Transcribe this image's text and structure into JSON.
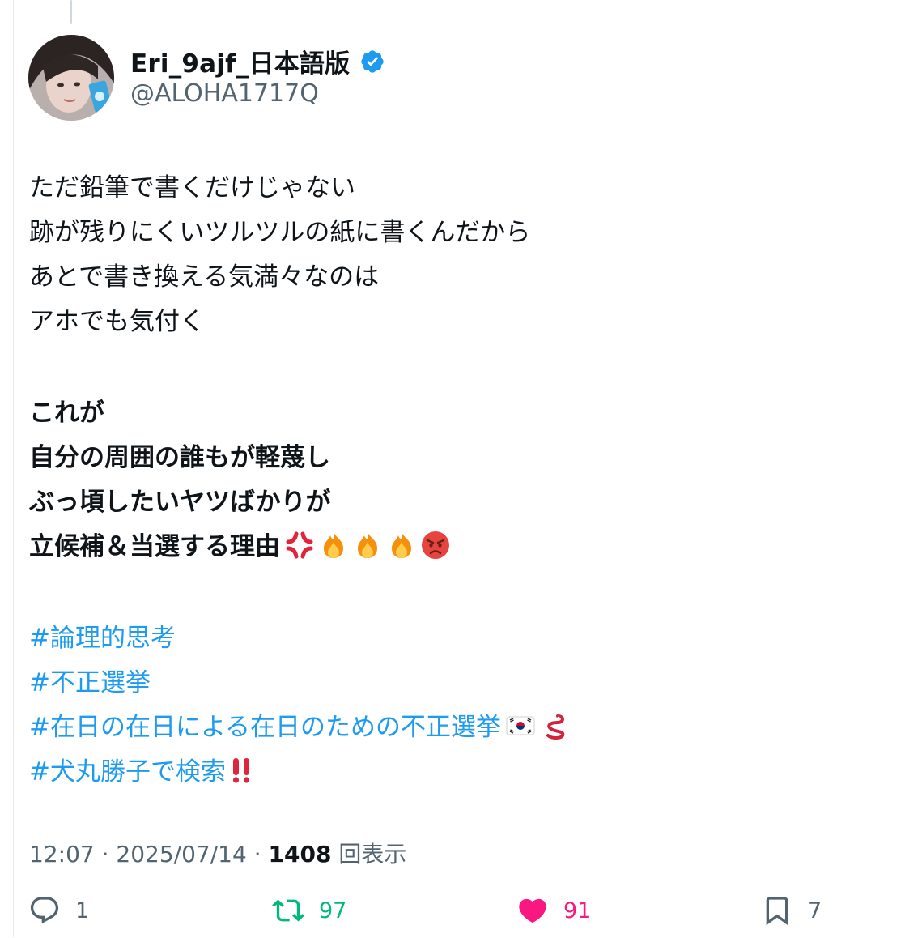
{
  "author": {
    "display_name": "Eri_9ajf_日本語版",
    "handle": "@ALOHA1717Q"
  },
  "tweet": {
    "paragraph1": [
      "ただ鉛筆で書くだけじゃない",
      "跡が残りにくいツルツルの紙に書くんだから",
      "あとで書き換える気満々なのは",
      "アホでも気付く"
    ],
    "paragraph2": [
      "これが",
      "自分の周囲の誰もが軽蔑し",
      "ぶっ頃したいヤツばかりが",
      "立候補＆当選する理由"
    ],
    "hashtags": [
      "#論理的思考",
      "#不正選挙",
      "#在日の在日による在日のための不正選挙",
      "#犬丸勝子で検索"
    ],
    "emoji_names": [
      "anger-symbol",
      "fire",
      "fire",
      "fire",
      "pouting-face",
      "korean-flag",
      "snake",
      "double-exclamation"
    ]
  },
  "meta": {
    "time": "12:07",
    "date": "2025/07/14",
    "views": "1408",
    "views_label": "回表示"
  },
  "actions": {
    "replies": "1",
    "retweets": "97",
    "likes": "91",
    "bookmarks": "7"
  },
  "colors": {
    "accent": "#1d9bf0",
    "retweet": "#00ba7c",
    "like": "#f91880",
    "muted": "#536471"
  }
}
